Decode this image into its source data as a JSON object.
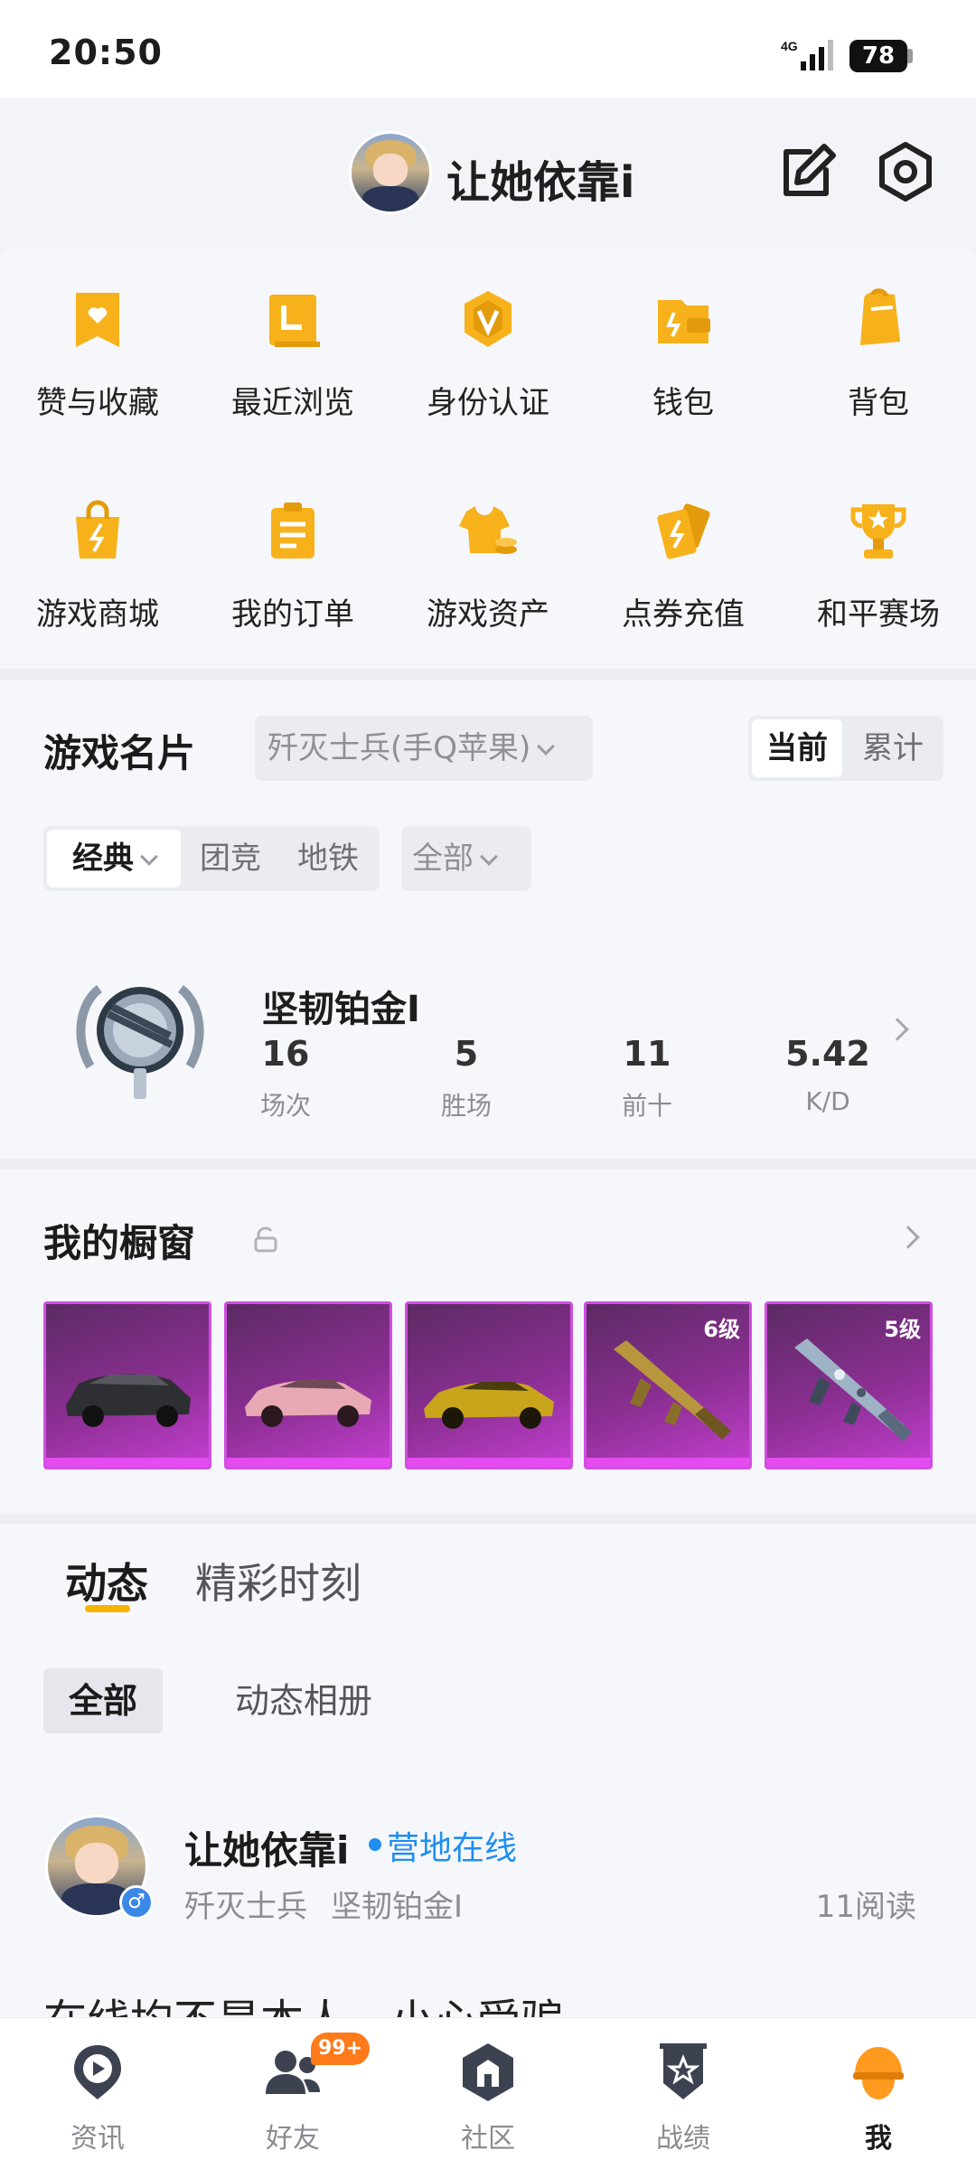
{
  "status_bar": {
    "time": "20:50",
    "network": "4G",
    "battery": "78"
  },
  "header": {
    "username": "让她依靠i"
  },
  "quick_grid": [
    {
      "label": "赞与收藏",
      "icon": "heart-bookmark-icon"
    },
    {
      "label": "最近浏览",
      "icon": "recent-browse-icon"
    },
    {
      "label": "身份认证",
      "icon": "verify-badge-icon"
    },
    {
      "label": "钱包",
      "icon": "wallet-icon"
    },
    {
      "label": "背包",
      "icon": "backpack-icon"
    },
    {
      "label": "游戏商城",
      "icon": "shopping-bag-icon"
    },
    {
      "label": "我的订单",
      "icon": "order-list-icon"
    },
    {
      "label": "游戏资产",
      "icon": "game-asset-icon"
    },
    {
      "label": "点券充值",
      "icon": "coupon-topup-icon"
    },
    {
      "label": "和平赛场",
      "icon": "trophy-icon"
    }
  ],
  "game_card": {
    "title": "游戏名片",
    "account": "歼灭士兵(手Q苹果)",
    "toggle": {
      "current": "当前",
      "total": "累计"
    },
    "modes": {
      "classic": "经典",
      "team": "团竞",
      "metro": "地铁",
      "all": "全部"
    },
    "rank": "坚韧铂金I",
    "stats": [
      {
        "value": "16",
        "label": "场次"
      },
      {
        "value": "5",
        "label": "胜场"
      },
      {
        "value": "11",
        "label": "前十"
      },
      {
        "value": "5.42",
        "label": "K/D"
      }
    ]
  },
  "showcase": {
    "title": "我的橱窗",
    "items": [
      {
        "name": "black-suv-item",
        "level": ""
      },
      {
        "name": "pink-sedan-item",
        "level": ""
      },
      {
        "name": "gold-sports-car-item",
        "level": ""
      },
      {
        "name": "gold-rifle-item",
        "level": "6级"
      },
      {
        "name": "camo-rifle-item",
        "level": "5级"
      }
    ]
  },
  "feed": {
    "tabs": [
      "动态",
      "精彩时刻"
    ],
    "filters": [
      "全部",
      "动态相册"
    ],
    "post": {
      "author": "让她依靠i",
      "online_status": "营地在线",
      "gender": "♂",
      "meta": [
        "歼灭士兵",
        "坚韧铂金I"
      ],
      "reads": "11阅读",
      "text": "在线均不是本人，小心受骗"
    }
  },
  "bottom_nav": {
    "items": [
      {
        "label": "资讯",
        "icon": "news-play-icon"
      },
      {
        "label": "好友",
        "icon": "friends-icon",
        "badge": "99+"
      },
      {
        "label": "社区",
        "icon": "community-icon"
      },
      {
        "label": "战绩",
        "icon": "battle-record-icon"
      },
      {
        "label": "我",
        "icon": "profile-helmet-icon"
      }
    ]
  },
  "colors": {
    "accent": "#f5b400",
    "online": "#1f8ef1",
    "badge": "#ff7a1a",
    "showcase": "#a13ab0"
  }
}
